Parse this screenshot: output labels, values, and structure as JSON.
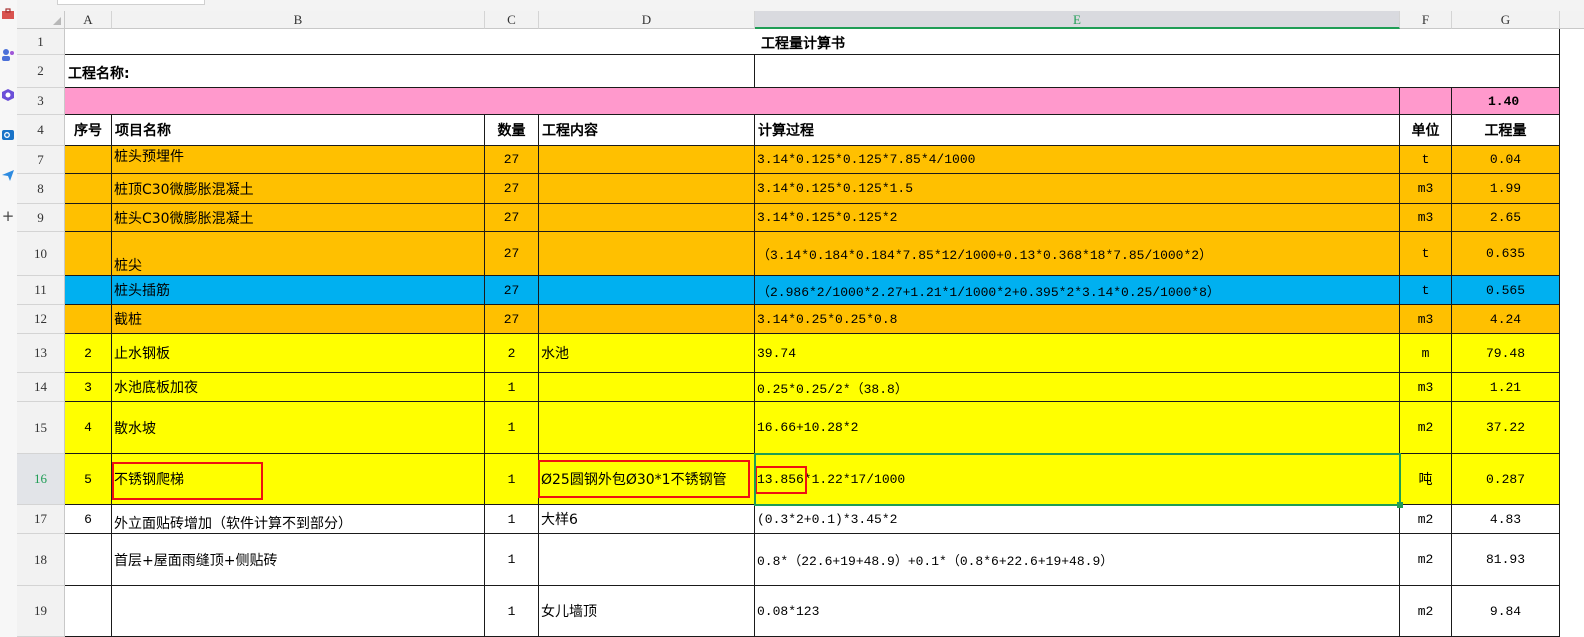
{
  "left_rail_icons": [
    "toolbox-icon",
    "people-icon",
    "hexagon-app-icon",
    "outlook-icon",
    "send-icon",
    "plus-icon"
  ],
  "left_rail_plus": "+",
  "colors": {
    "pink": "#ff99cc",
    "orange": "#ffc000",
    "blue": "#00b0f0",
    "yellow": "#ffff00",
    "selection": "#1f9d55",
    "highlight": "#ee1111"
  },
  "column_headers": [
    "A",
    "B",
    "C",
    "D",
    "E",
    "F",
    "G"
  ],
  "active_column": "E",
  "row_numbers": [
    "1",
    "2",
    "3",
    "4",
    "7",
    "8",
    "9",
    "10",
    "11",
    "12",
    "13",
    "14",
    "15",
    "16",
    "17",
    "18",
    "19"
  ],
  "active_row": "16",
  "sheet": {
    "title": "工程量计算书",
    "project_name_label": "工程名称:",
    "row3_total": "1.40",
    "headers": {
      "seq": "序号",
      "item": "项目名称",
      "qty": "数量",
      "content": "工程内容",
      "calc": "计算过程",
      "unit": "单位",
      "amount": "工程量"
    },
    "rows": [
      {
        "seq": "",
        "item": "桩头预埋件",
        "qty": "27",
        "content": "",
        "calc": "3.14*0.125*0.125*7.85*4/1000",
        "unit": "t",
        "amount": "0.04"
      },
      {
        "seq": "",
        "item": "桩顶C30微膨胀混凝土",
        "qty": "27",
        "content": "",
        "calc": "3.14*0.125*0.125*1.5",
        "unit": "m3",
        "amount": "1.99"
      },
      {
        "seq": "",
        "item": "桩头C30微膨胀混凝土",
        "qty": "27",
        "content": "",
        "calc": "3.14*0.125*0.125*2",
        "unit": "m3",
        "amount": "2.65"
      },
      {
        "seq": "",
        "item": "桩尖",
        "qty": "27",
        "content": "",
        "calc": "（3.14*0.184*0.184*7.85*12/1000+0.13*0.368*18*7.85/1000*2）",
        "unit": "t",
        "amount": "0.635"
      },
      {
        "seq": "",
        "item": "桩头插筋",
        "qty": "27",
        "content": "",
        "calc": "（2.986*2/1000*2.27+1.21*1/1000*2+0.395*2*3.14*0.25/1000*8）",
        "unit": "t",
        "amount": "0.565"
      },
      {
        "seq": "",
        "item": "截桩",
        "qty": "27",
        "content": "",
        "calc": "3.14*0.25*0.25*0.8",
        "unit": "m3",
        "amount": "4.24"
      },
      {
        "seq": "2",
        "item": "止水钢板",
        "qty": "2",
        "content": "水池",
        "calc": "39.74",
        "unit": "m",
        "amount": "79.48"
      },
      {
        "seq": "3",
        "item": "水池底板加夜",
        "qty": "1",
        "content": "",
        "calc": "0.25*0.25/2*（38.8）",
        "unit": "m3",
        "amount": "1.21"
      },
      {
        "seq": "4",
        "item": "散水坡",
        "qty": "1",
        "content": "",
        "calc": "16.66+10.28*2",
        "unit": "m2",
        "amount": "37.22"
      },
      {
        "seq": "5",
        "item": "不锈钢爬梯",
        "qty": "1",
        "content": "Ø25圆钢外包Ø30*1不锈钢管",
        "calc": "13.856*1.22*17/1000",
        "unit": "吨",
        "amount": "0.287"
      },
      {
        "seq": "6",
        "item": "外立面贴砖增加（软件计算不到部分）",
        "qty": "1",
        "content": "大样6",
        "calc": "(0.3*2+0.1)*3.45*2",
        "unit": "m2",
        "amount": "4.83"
      },
      {
        "seq": "",
        "item": "首层+屋面雨缝顶+侧贴砖",
        "qty": "1",
        "content": "",
        "calc": "0.8*（22.6+19+48.9）+0.1*（0.8*6+22.6+19+48.9）",
        "unit": "m2",
        "amount": "81.93"
      },
      {
        "seq": "",
        "item": "",
        "qty": "1",
        "content": "女儿墙顶",
        "calc": "0.08*123",
        "unit": "m2",
        "amount": "9.84"
      }
    ]
  }
}
